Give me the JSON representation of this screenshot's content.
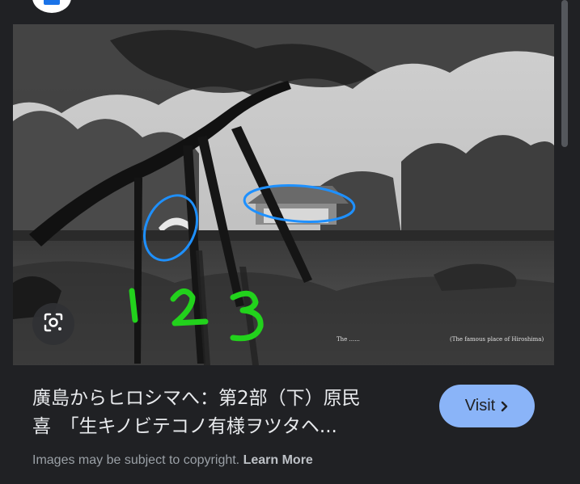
{
  "result": {
    "title_line1": "廣島からヒロシマへ：第2部（下）原民",
    "title_line2": "喜　「生キノビテコノ有様ヲツタヘ...",
    "visit_label": "Visit",
    "copyright_text": "Images may be subject to copyright.",
    "learn_more_label": "Learn More"
  },
  "image": {
    "annotation_text": "1 2 3",
    "annotation_color": "#22d21c",
    "circle_color": "#1e90ff"
  },
  "icons": {
    "lens": "google-lens-icon",
    "visit": "chevron-right-icon",
    "site": "site-favicon-icon"
  },
  "colors": {
    "background": "#202124",
    "title": "#e8eaed",
    "visit_button": "#8ab4f8",
    "muted_text": "#9aa0a6"
  }
}
